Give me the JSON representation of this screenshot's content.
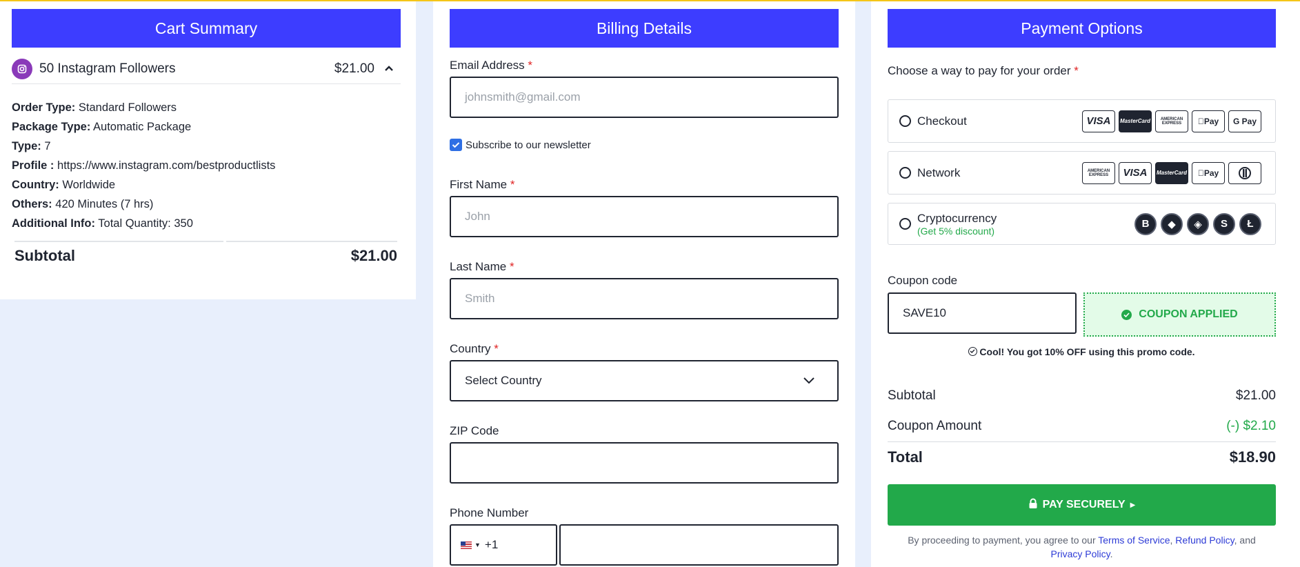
{
  "cart": {
    "title": "Cart Summary",
    "item_name": "50 Instagram Followers",
    "item_price": "$21.00",
    "details": [
      {
        "key": "Order Type:",
        "value": "Standard Followers"
      },
      {
        "key": "Package Type:",
        "value": "Automatic Package"
      },
      {
        "key": "Type:",
        "value": "7"
      },
      {
        "key": "Profile :",
        "value": "https://www.instagram.com/bestproductlists"
      },
      {
        "key": "Country:",
        "value": "Worldwide"
      },
      {
        "key": "Others:",
        "value": "420 Minutes (7 hrs)"
      },
      {
        "key": "Additional Info:",
        "value": "Total Quantity: 350"
      }
    ],
    "subtotal_label": "Subtotal",
    "subtotal_value": "$21.00"
  },
  "billing": {
    "title": "Billing Details",
    "email_label": "Email Address",
    "email_placeholder": "johnsmith@gmail.com",
    "newsletter_label": "Subscribe to our newsletter",
    "newsletter_checked": true,
    "first_label": "First Name",
    "first_placeholder": "John",
    "last_label": "Last Name",
    "last_placeholder": "Smith",
    "country_label": "Country",
    "country_value": "Select Country",
    "zip_label": "ZIP Code",
    "zip_value": "",
    "phone_label": "Phone Number",
    "phone_code": "+1",
    "phone_value": "",
    "required_mark": "*"
  },
  "payment": {
    "title": "Payment Options",
    "choose_label": "Choose a way to pay for your order",
    "options": [
      {
        "name": "Checkout",
        "cards": [
          "VISA",
          "MasterCard",
          "AMERICAN EXPRESS",
          "Pay",
          "G Pay"
        ]
      },
      {
        "name": "Network",
        "cards": [
          "AMERICAN EXPRESS",
          "VISA",
          "MasterCard",
          "Pay",
          "Diners"
        ]
      },
      {
        "name": "Cryptocurrency",
        "note": "(Get 5% discount)",
        "coins": [
          "B",
          "◆",
          "◈",
          "S",
          "Ł"
        ]
      }
    ],
    "coupon_label": "Coupon code",
    "coupon_value": "SAVE10",
    "coupon_status": "COUPON APPLIED",
    "coupon_message": "Cool! You got 10% OFF using this promo code.",
    "subtotal_label": "Subtotal",
    "subtotal_value": "$21.00",
    "coupon_amount_label": "Coupon Amount",
    "coupon_amount_value": "(-) $2.10",
    "total_label": "Total",
    "total_value": "$18.90",
    "pay_label": "PAY SECURELY",
    "legal_prefix": "By proceeding to payment, you agree to our",
    "tos": "Terms of Service",
    "refund": "Refund Policy",
    "and_text": ", and",
    "privacy": "Privacy Policy",
    "period": "."
  },
  "colors": {
    "accent": "#3d3dff",
    "green": "#22a94a",
    "background": "#e8effc",
    "required": "#e02424",
    "instagram": "#8a3ab9",
    "link": "#2d3bd6"
  }
}
